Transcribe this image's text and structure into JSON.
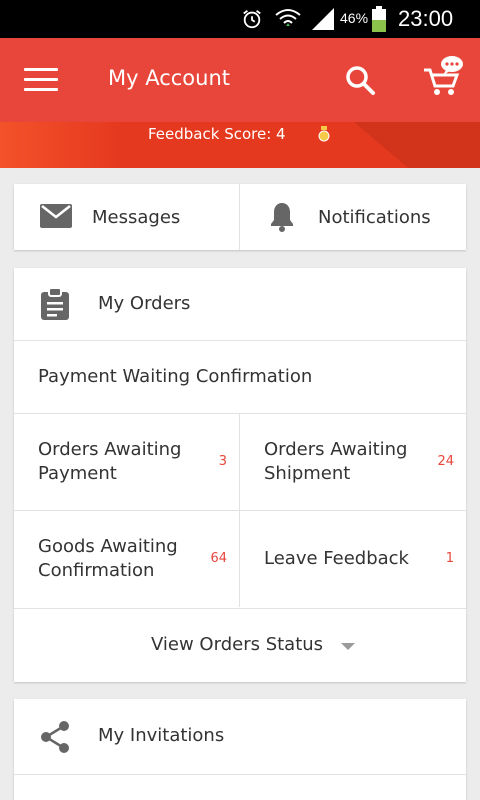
{
  "status_bar": {
    "battery_percent": "46%",
    "time": "23:00"
  },
  "app_bar": {
    "title": "My Account"
  },
  "banner": {
    "feedback_score": "Feedback Score: 4"
  },
  "quick_links": {
    "messages": "Messages",
    "notifications": "Notifications"
  },
  "orders": {
    "title": "My Orders",
    "payment_waiting": "Payment Waiting Confirmation",
    "items": [
      {
        "label": "Orders Awaiting Payment",
        "count": "3"
      },
      {
        "label": "Orders Awaiting Shipment",
        "count": "24"
      },
      {
        "label": "Goods Awaiting Confirmation",
        "count": "64"
      },
      {
        "label": "Leave Feedback",
        "count": "1"
      }
    ],
    "view_status": "View Orders Status"
  },
  "invitations": {
    "title": "My Invitations"
  },
  "colors": {
    "primary": "#e8463b",
    "banner": "#e5391f",
    "count": "#e8463b"
  }
}
